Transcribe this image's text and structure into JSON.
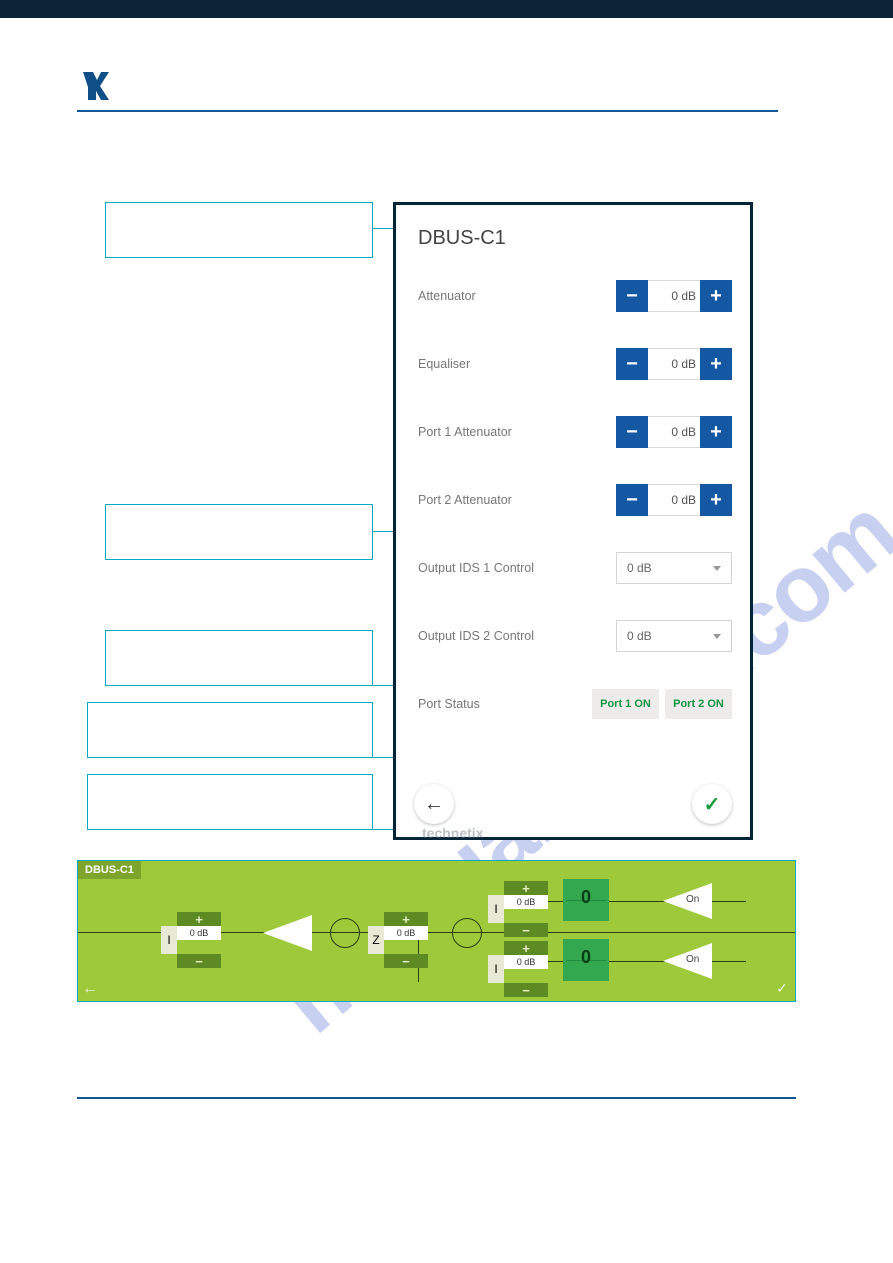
{
  "watermark": "manualshive.com",
  "phone": {
    "title": "DBUS-C1",
    "brand_footer": "technetix",
    "rows": {
      "attenuator": {
        "label": "Attenuator",
        "value": "0 dB"
      },
      "equaliser": {
        "label": "Equaliser",
        "value": "0 dB"
      },
      "port1att": {
        "label": "Port 1 Attenuator",
        "value": "0 dB"
      },
      "port2att": {
        "label": "Port 2 Attenuator",
        "value": "0 dB"
      },
      "ids1": {
        "label": "Output IDS 1 Control",
        "value": "0 dB"
      },
      "ids2": {
        "label": "Output IDS 2 Control",
        "value": "0 dB"
      },
      "portstatus_label": "Port Status"
    },
    "buttons": {
      "port1": "Port 1 ON",
      "port2": "Port 2 ON",
      "back": "←",
      "confirm": "✓",
      "minus": "−",
      "plus": "+"
    }
  },
  "diagram": {
    "tag": "DBUS-C1",
    "plus": "+",
    "minus": "−",
    "letter_i": "I",
    "letter_z": "Z",
    "val_db": "0  dB",
    "trap_val": "0",
    "tri_on": "On",
    "arrow_back": "←",
    "ok": "✓"
  }
}
